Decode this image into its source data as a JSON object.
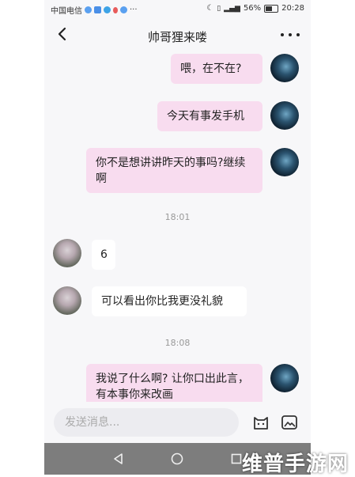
{
  "status_bar": {
    "carrier": "中国电信",
    "more": "···",
    "battery_pct": "56%",
    "time": "20:28"
  },
  "header": {
    "title": "帅哥狸来喽"
  },
  "messages": [
    {
      "text": "喂，在不在?"
    },
    {
      "text": "今天有事发手机"
    },
    {
      "text": "你不是想讲讲昨天的事吗?继续啊"
    },
    {
      "text": "6"
    },
    {
      "text": "可以看出你比我更没礼貌"
    },
    {
      "text": "我说了什么啊? 让你口出此言，有本事你来改画"
    }
  ],
  "timestamps": [
    "18:01",
    "18:08"
  ],
  "input": {
    "placeholder": "发送消息..."
  },
  "watermark": "维普手游网",
  "colors": {
    "my_bubble": "#f8dcef",
    "their_bubble": "#ffffff",
    "background": "#f7f7f9",
    "nav_bar": "#7d7d7d"
  }
}
